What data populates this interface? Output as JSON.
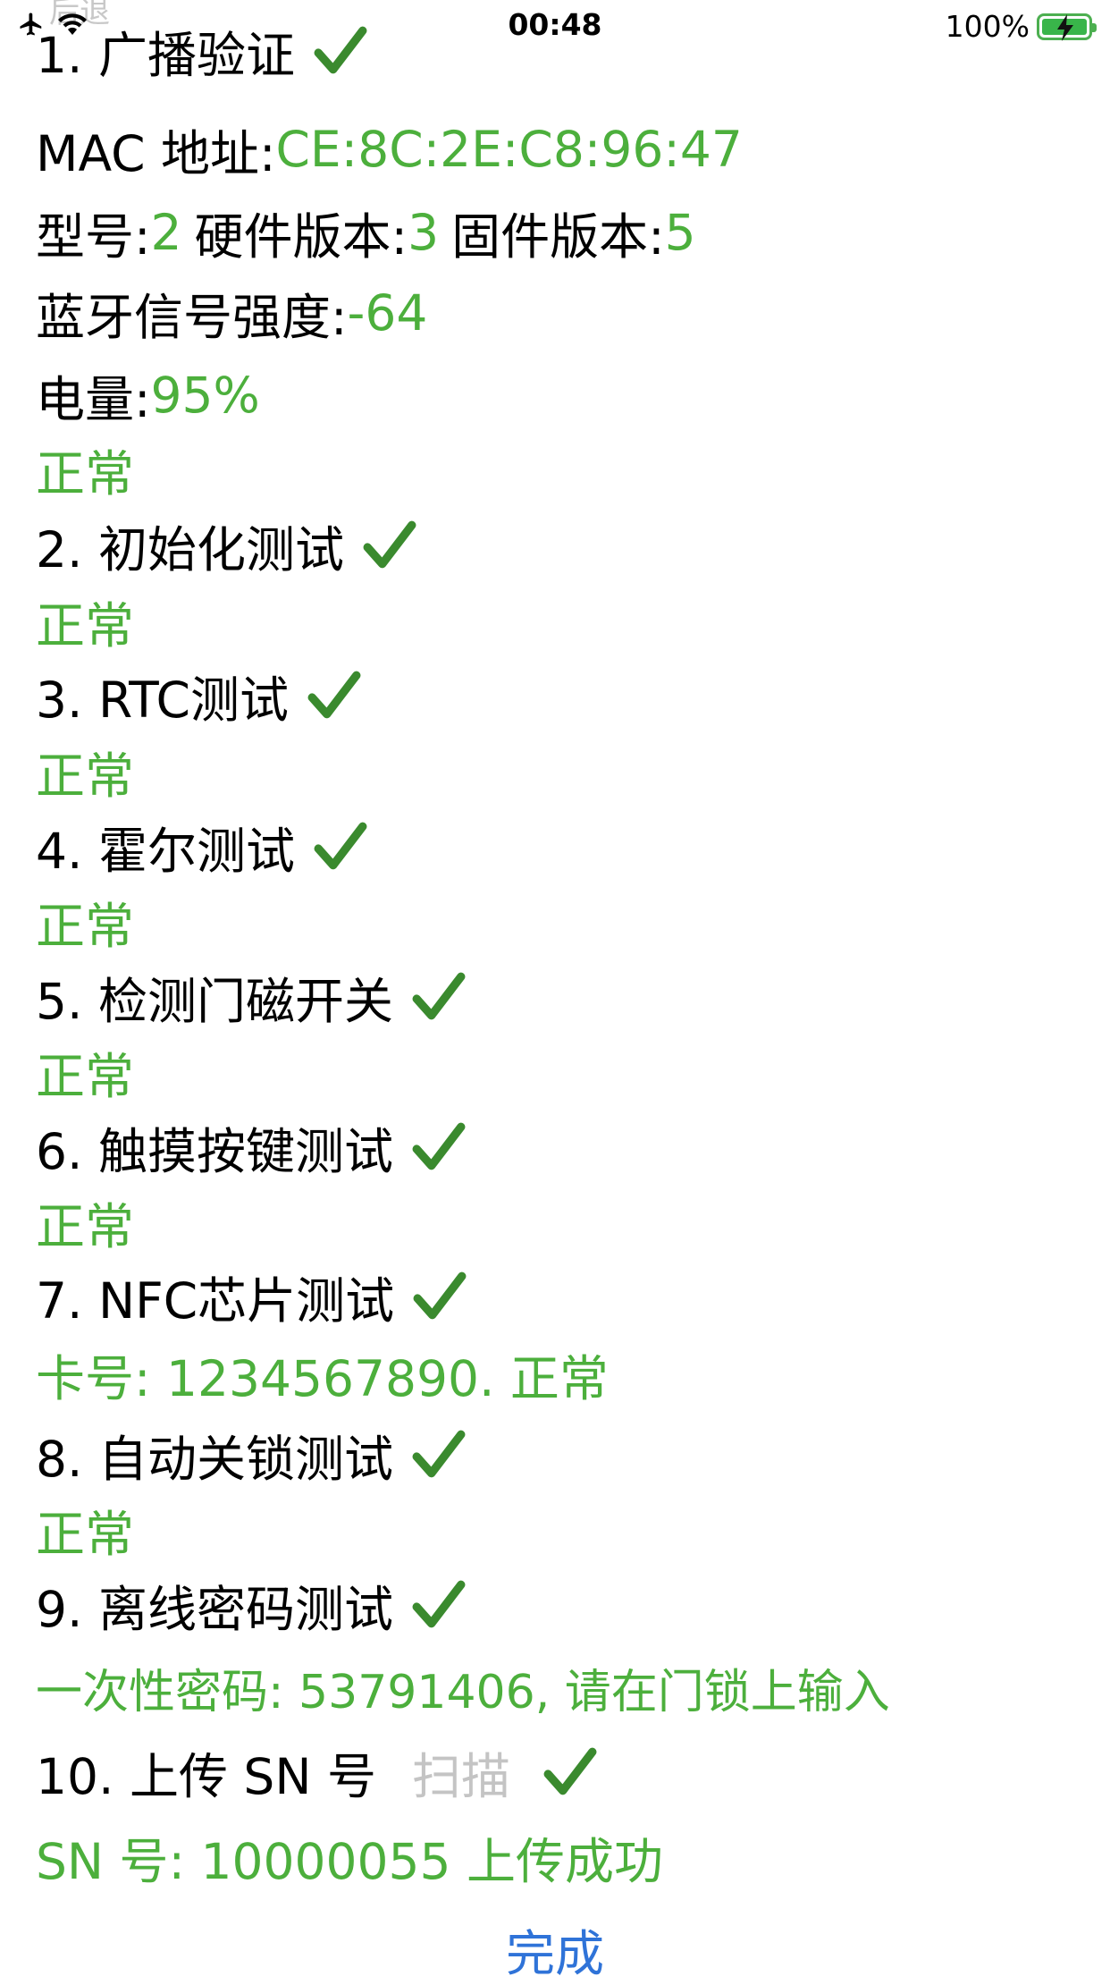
{
  "status_bar": {
    "faded_title": "后退",
    "time": "00:48",
    "battery_percent": "100%",
    "battery_level": 1.0,
    "icons": [
      "airplane-icon",
      "wifi-icon",
      "battery-charging-icon"
    ]
  },
  "colors": {
    "ok_green": "#4caf3c",
    "check_green": "#3a8a2e",
    "link_blue": "#2f73d8",
    "muted_gray": "#c4c4c4"
  },
  "tests": [
    {
      "title": "1. 广播验证",
      "passed": true
    },
    {
      "title": "2. 初始化测试",
      "result": "正常",
      "passed": true
    },
    {
      "title": "3. RTC测试",
      "result": "正常",
      "passed": true
    },
    {
      "title": "4. 霍尔测试",
      "result": "正常",
      "passed": true
    },
    {
      "title": "5. 检测门磁开关",
      "result": "正常",
      "passed": true
    },
    {
      "title": "6. 触摸按键测试",
      "result": "正常",
      "passed": true
    },
    {
      "title": "7. NFC芯片测试",
      "result": "卡号: 1234567890. 正常",
      "passed": true
    },
    {
      "title": "8. 自动关锁测试",
      "result": "正常",
      "passed": true
    },
    {
      "title": "9. 离线密码测试",
      "result": "一次性密码: 53791406, 请在门锁上输入",
      "passed": true
    },
    {
      "title": "10. 上传 SN 号",
      "action_label": "扫描",
      "result": "SN 号: 10000055 上传成功",
      "passed": true
    }
  ],
  "broadcast": {
    "mac_label": "MAC 地址: ",
    "mac_value": "CE:8C:2E:C8:96:47",
    "model_label": "型号: ",
    "model_value": "2",
    "hw_label": "硬件版本: ",
    "hw_value": "3",
    "fw_label": "固件版本: ",
    "fw_value": "5",
    "rssi_label": "蓝牙信号强度: ",
    "rssi_value": "-64",
    "battery_label": "电量: ",
    "battery_value": "95%",
    "result": "正常"
  },
  "done_label": "完成"
}
